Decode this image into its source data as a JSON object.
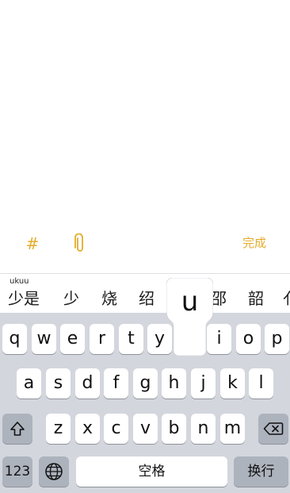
{
  "toolbar": {
    "hash_label": "#",
    "attach_icon": "paperclip-icon",
    "done_label": "完成",
    "accent_color": "#e4ac2c"
  },
  "candidates": {
    "pinyin": "ukuu",
    "items": [
      "少是",
      "少",
      "烧",
      "绍",
      "邵",
      "韶",
      "(partially hidden)"
    ]
  },
  "keyboard": {
    "row1": [
      "q",
      "w",
      "e",
      "r",
      "t",
      "y",
      "u",
      "i",
      "o",
      "p"
    ],
    "row2": [
      "a",
      "s",
      "d",
      "f",
      "g",
      "h",
      "j",
      "k",
      "l"
    ],
    "row3": [
      "z",
      "x",
      "c",
      "v",
      "b",
      "n",
      "m"
    ],
    "shift_icon": "shift-icon",
    "delete_icon": "delete-icon",
    "numbers_label": "123",
    "globe_icon": "globe-icon",
    "space_label": "空格",
    "return_label": "换行",
    "pressed_key": "u"
  }
}
